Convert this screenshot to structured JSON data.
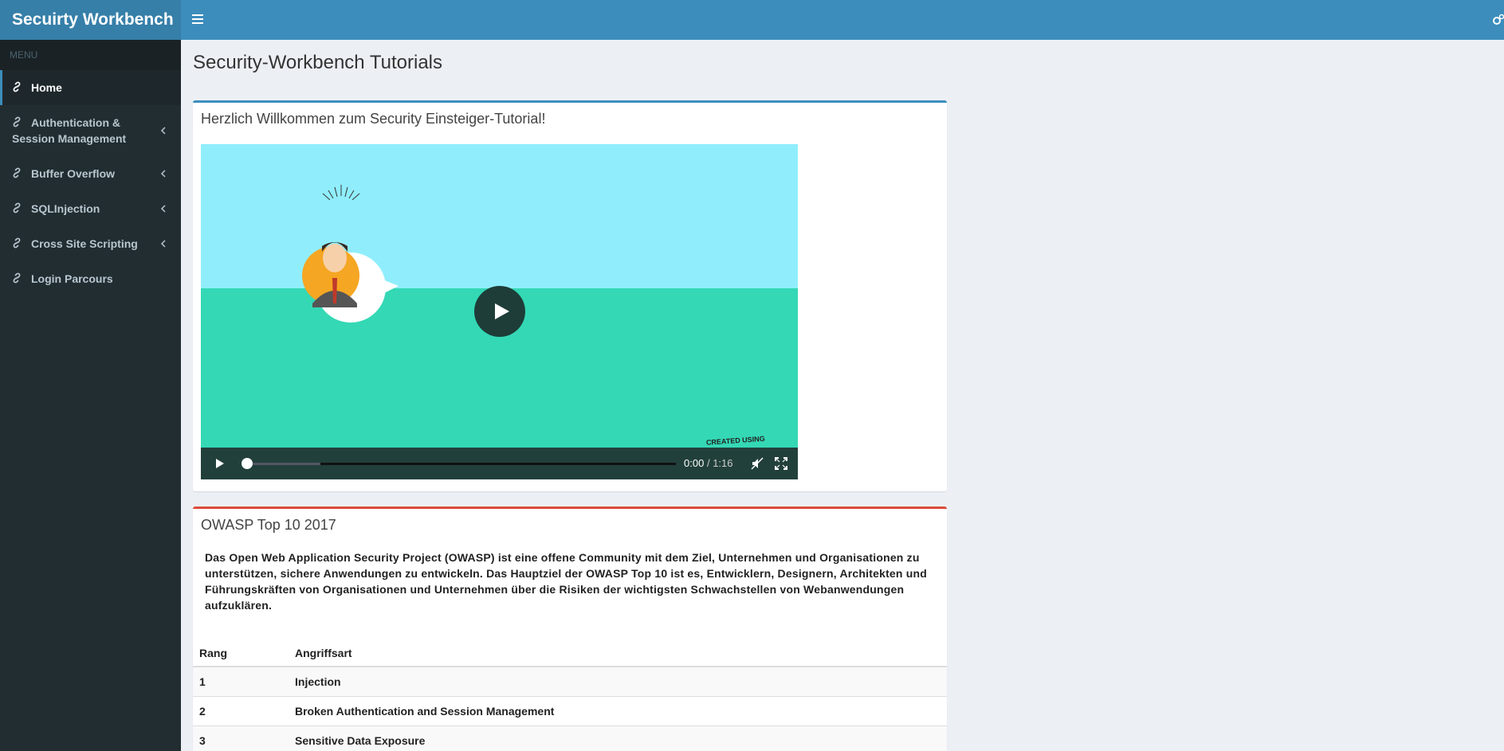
{
  "header": {
    "brand": "Secuirty Workbench"
  },
  "sidebar": {
    "menu_header": "MENU",
    "items": [
      {
        "label": "Home",
        "active": true
      },
      {
        "label_line1": "Authentication &",
        "label_line2": "Session Management"
      },
      {
        "label": "Buffer Overflow"
      },
      {
        "label": "SQLInjection"
      },
      {
        "label": "Cross Site Scripting"
      },
      {
        "label": "Login Parcours"
      }
    ]
  },
  "main": {
    "page_title": "Security-Workbench Tutorials",
    "video_box": {
      "title": "Herzlich Willkommen zum Security Einsteiger-Tutorial!",
      "player": {
        "current_time": "0:00",
        "separator": "/",
        "duration": "1:16",
        "buffered_fraction": 0.18,
        "watermark": "CREATED USING"
      }
    },
    "owasp_box": {
      "title": "OWASP Top 10 2017",
      "description": "Das Open Web Application Security Project (OWASP) ist eine offene Community mit dem Ziel, Unternehmen und Organisationen zu unterstützen, sichere Anwendungen zu entwickeln. Das Hauptziel der OWASP Top 10 ist es, Entwicklern, Designern, Architekten und Führungskräften von Organisationen und Unternehmen über die Risiken der wichtigsten Schwachstellen von Webanwendungen aufzuklären.",
      "table": {
        "headers": [
          "Rang",
          "Angriffsart"
        ],
        "rows": [
          {
            "rank": "1",
            "attack": "Injection"
          },
          {
            "rank": "2",
            "attack": "Broken Authentication and Session Management"
          },
          {
            "rank": "3",
            "attack": "Sensitive Data Exposure"
          }
        ]
      }
    }
  },
  "colors": {
    "header": "#3c8dbc",
    "brand": "#367fa9",
    "sidebar": "#222d32",
    "danger": "#dd4b39"
  }
}
